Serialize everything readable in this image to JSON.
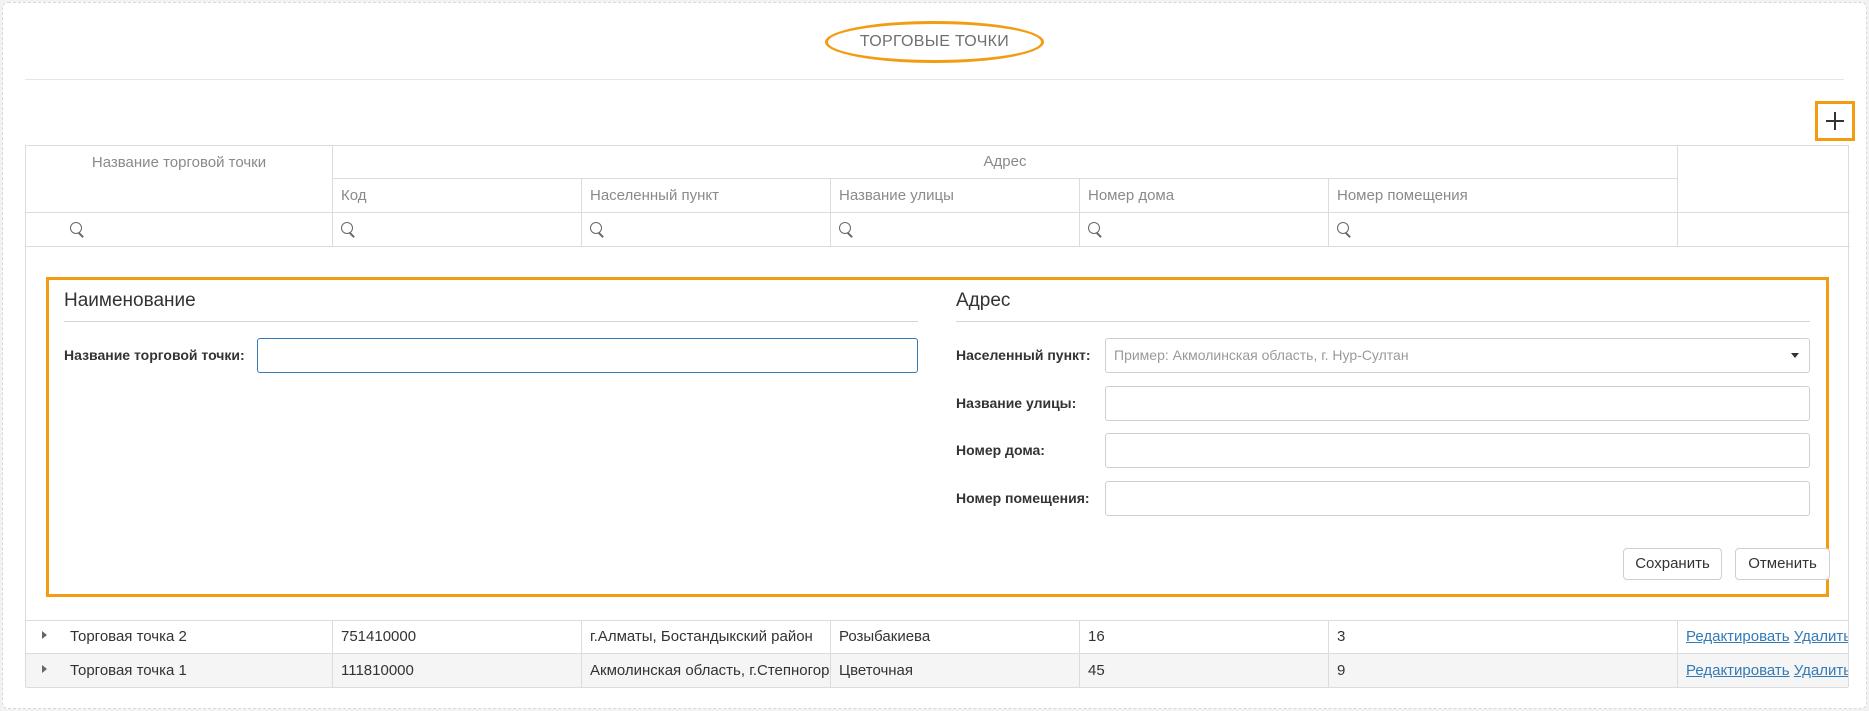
{
  "page": {
    "title": "ТОРГОВЫЕ ТОЧКИ"
  },
  "toolbar": {
    "add_icon": "plus-icon"
  },
  "grid": {
    "headers": {
      "name": "Название торговой точки",
      "address": "Адрес",
      "code": "Код",
      "locality": "Населенный пункт",
      "street": "Название улицы",
      "house": "Номер дома",
      "room": "Номер помещения"
    },
    "filter_icon": "search-icon",
    "rows": [
      {
        "name": "Торговая точка 2",
        "code": "751410000",
        "locality": "г.Алматы, Бостандыкский район",
        "street": "Розыбакиева",
        "house": "16",
        "room": "3",
        "edit": "Редактировать",
        "delete": "Удалить"
      },
      {
        "name": "Торговая точка 1",
        "code": "111810000",
        "locality": "Акмолинская область, г.Степногорск",
        "street": "Цветочная",
        "house": "45",
        "room": "9",
        "edit": "Редактировать",
        "delete": "Удалить"
      }
    ]
  },
  "form": {
    "name_section": "Наименование",
    "address_section": "Адрес",
    "name_label": "Название торговой точки:",
    "name_value": "",
    "locality_label": "Населенный пункт:",
    "locality_placeholder": "Пример: Акмолинская область, г. Нур-Султан",
    "street_label": "Название улицы:",
    "street_value": "",
    "house_label": "Номер дома:",
    "house_value": "",
    "room_label": "Номер помещения:",
    "room_value": "",
    "save": "Сохранить",
    "cancel": "Отменить"
  },
  "colors": {
    "accent": "#f39c12",
    "link": "#337ab7"
  }
}
